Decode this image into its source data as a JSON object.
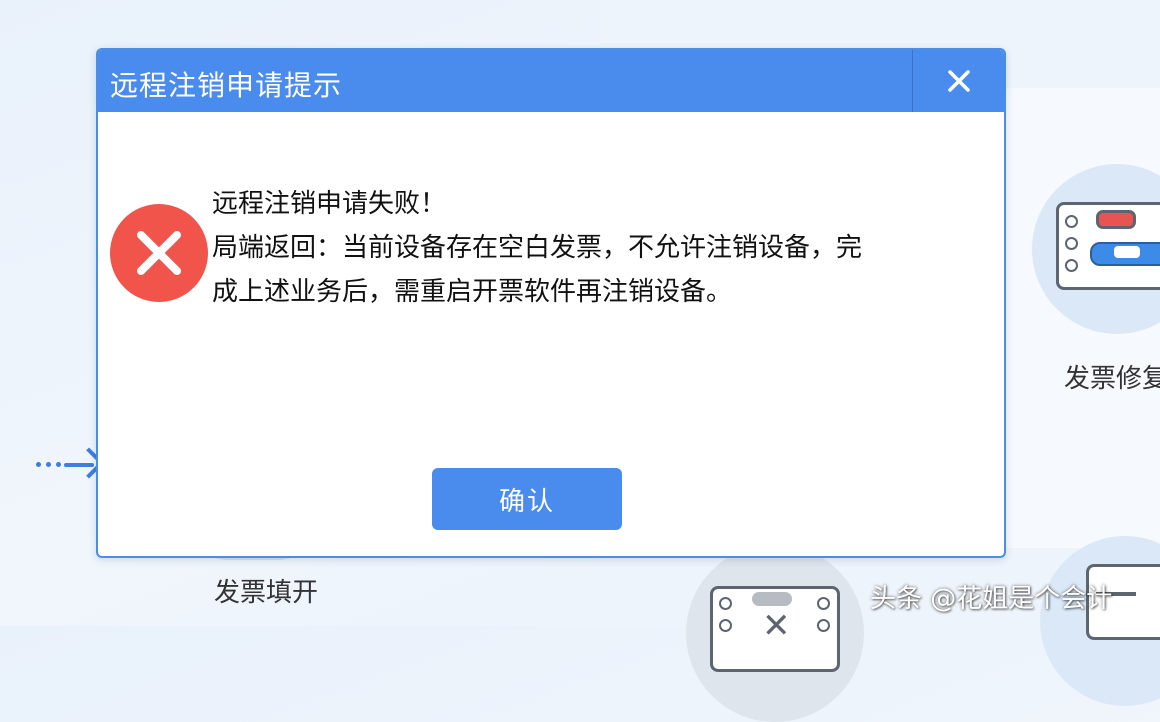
{
  "background": {
    "label_left": "发票填开",
    "label_right": "发票修复",
    "watermark": "头条 @花姐是个会计"
  },
  "dialog": {
    "title": "远程注销申请提示",
    "message_lines": [
      "远程注销申请失败！",
      "局端返回：当前设备存在空白发票，不允许注销设备，完",
      "成上述业务后，需重启开票软件再注销设备。"
    ],
    "ok_label": "确认",
    "icons": {
      "close": "close-icon",
      "error": "error-icon"
    }
  },
  "colors": {
    "titlebar": "#4a8bee",
    "button": "#4a8bee",
    "error": "#f0544a"
  }
}
